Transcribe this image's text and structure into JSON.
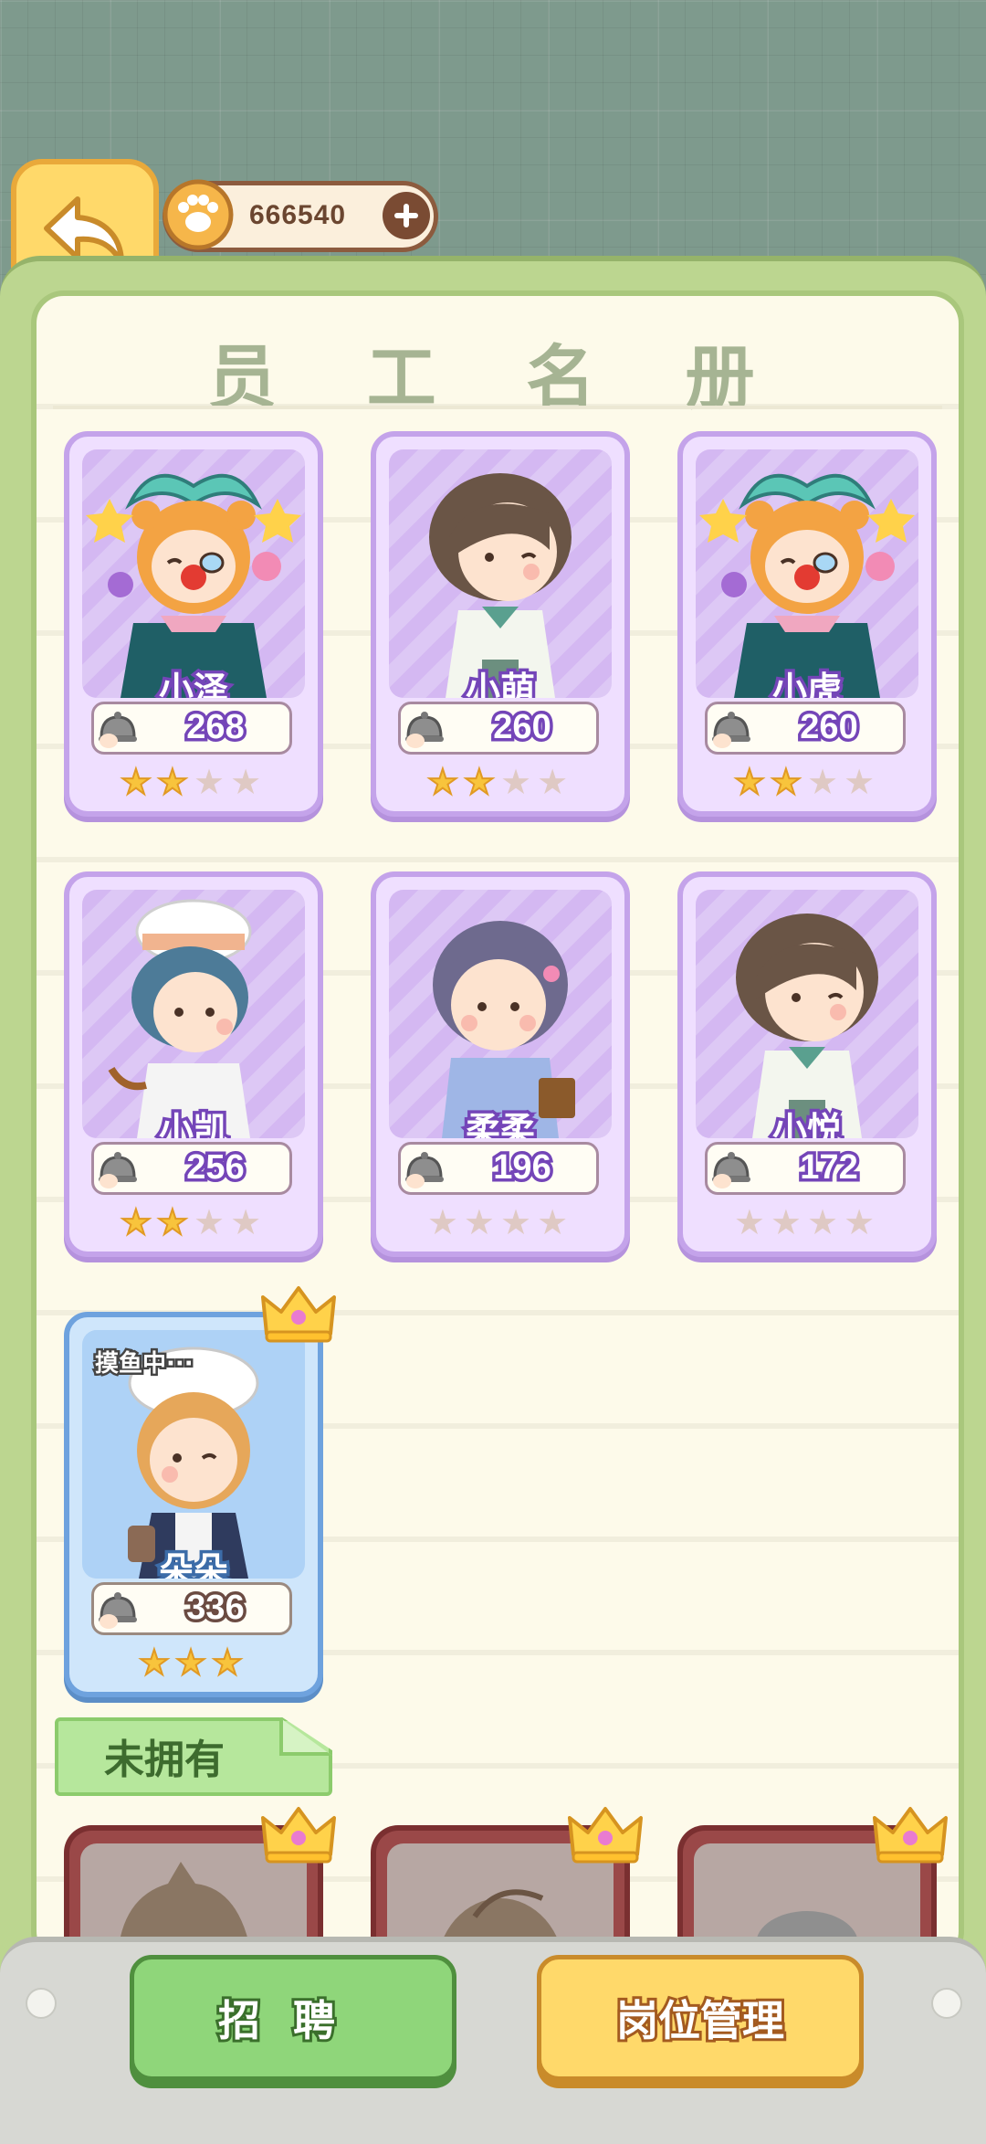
{
  "header": {
    "back_icon": "back-arrow-icon",
    "currency_icon": "paw-coin-icon",
    "currency_value": "666540",
    "add_icon": "plus-icon"
  },
  "panel": {
    "title": "员 工 名 册"
  },
  "staff": [
    {
      "name": "小泽",
      "score": "268",
      "stars": 2,
      "max_stars": 4,
      "avatar": "clown-bear"
    },
    {
      "name": "小萌",
      "score": "260",
      "stars": 2,
      "max_stars": 4,
      "avatar": "brown-hair-waiter"
    },
    {
      "name": "小虎",
      "score": "260",
      "stars": 2,
      "max_stars": 4,
      "avatar": "clown-bear"
    },
    {
      "name": "小凯",
      "score": "256",
      "stars": 2,
      "max_stars": 4,
      "avatar": "chef-blue-hair"
    },
    {
      "name": "柔柔",
      "score": "196",
      "stars": 0,
      "max_stars": 4,
      "avatar": "purple-hair-girl"
    },
    {
      "name": "小悦",
      "score": "172",
      "stars": 0,
      "max_stars": 4,
      "avatar": "brown-hair-waiter"
    }
  ],
  "special_staff": {
    "name": "朵朵",
    "score": "336",
    "stars": 3,
    "status": "摸鱼中···",
    "badge_icon": "crown-icon",
    "avatar": "blonde-chef"
  },
  "unowned": {
    "label": "未拥有",
    "count_visible": 3
  },
  "bottom": {
    "recruit_label": "招聘",
    "manage_label": "岗位管理"
  },
  "colors": {
    "card_purple": "#efdfff",
    "card_blue": "#cfe6fb",
    "star_on": "#f8c43c",
    "star_off": "#dfc9c4",
    "recruit_green": "#8fd67a",
    "manage_yellow": "#ffd96a"
  }
}
